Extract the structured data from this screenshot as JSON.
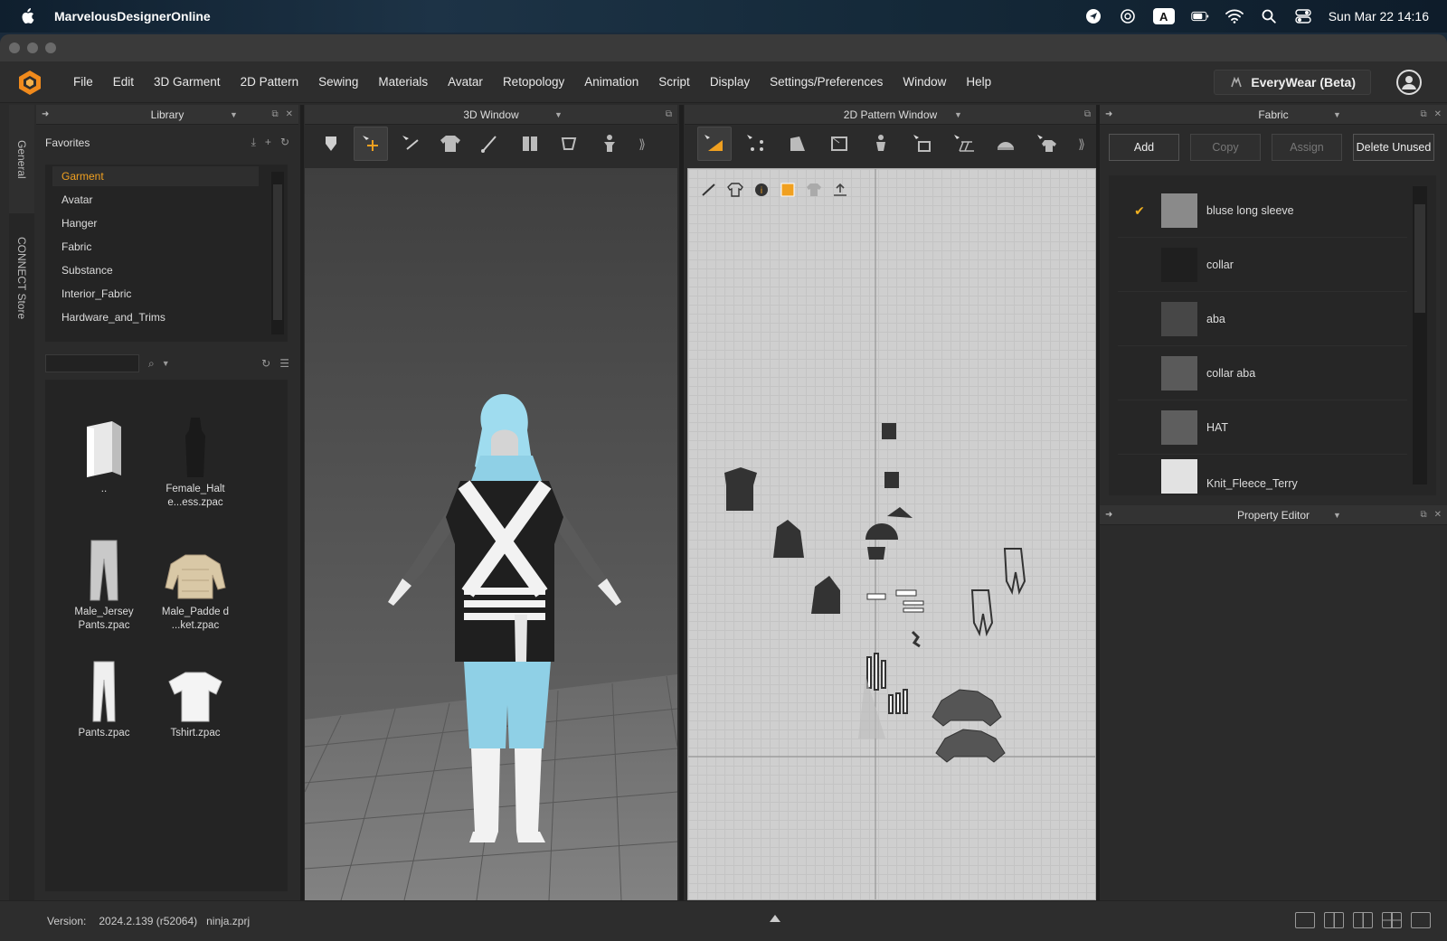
{
  "mac": {
    "app_name": "MarvelousDesignerOnline",
    "clock": "Sun Mar 22  14:16",
    "input_badge": "A"
  },
  "menu": {
    "items": [
      "File",
      "Edit",
      "3D Garment",
      "2D Pattern",
      "Sewing",
      "Materials",
      "Avatar",
      "Retopology",
      "Animation",
      "Script",
      "Display",
      "Settings/Preferences",
      "Window",
      "Help"
    ],
    "everywear": "EveryWear (Beta)"
  },
  "side_tabs": [
    "General",
    "CONNECT Store"
  ],
  "library": {
    "title": "Library",
    "favorites": "Favorites",
    "tree": [
      "Garment",
      "Avatar",
      "Hanger",
      "Fabric",
      "Substance",
      "Interior_Fabric",
      "Hardware_and_Trims"
    ],
    "active": "Garment",
    "search_placeholder": "",
    "items": [
      {
        "label": ".."
      },
      {
        "label": "Female_Halt e...ess.zpac"
      },
      {
        "label": "Male_Jersey Pants.zpac"
      },
      {
        "label": "Male_Padde d ...ket.zpac"
      },
      {
        "label": "Pants.zpac"
      },
      {
        "label": "Tshirt.zpac"
      }
    ]
  },
  "window3d": {
    "title": "3D Window"
  },
  "window2d": {
    "title": "2D Pattern Window"
  },
  "fabric": {
    "title": "Fabric",
    "buttons": {
      "add": "Add",
      "copy": "Copy",
      "assign": "Assign",
      "delete_unused": "Delete Unused"
    },
    "items": [
      {
        "name": "bluse long sleeve",
        "checked": true,
        "color": "#8a8a8a"
      },
      {
        "name": "collar",
        "checked": false,
        "color": "#1f1f1f"
      },
      {
        "name": "aba",
        "checked": false,
        "color": "#474747"
      },
      {
        "name": "collar aba",
        "checked": false,
        "color": "#5a5a5a"
      },
      {
        "name": "HAT",
        "checked": false,
        "color": "#5e5e5e"
      },
      {
        "name": "Knit_Fleece_Terry",
        "checked": false,
        "color": "#e2e2e2"
      }
    ]
  },
  "property_editor": {
    "title": "Property Editor"
  },
  "status": {
    "version_label": "Version:",
    "version_value": "2024.2.139 (r52064)",
    "file": "ninja.zprj"
  },
  "colors": {
    "accent": "#f0a020",
    "avatar_blue": "#8fd0e6"
  }
}
